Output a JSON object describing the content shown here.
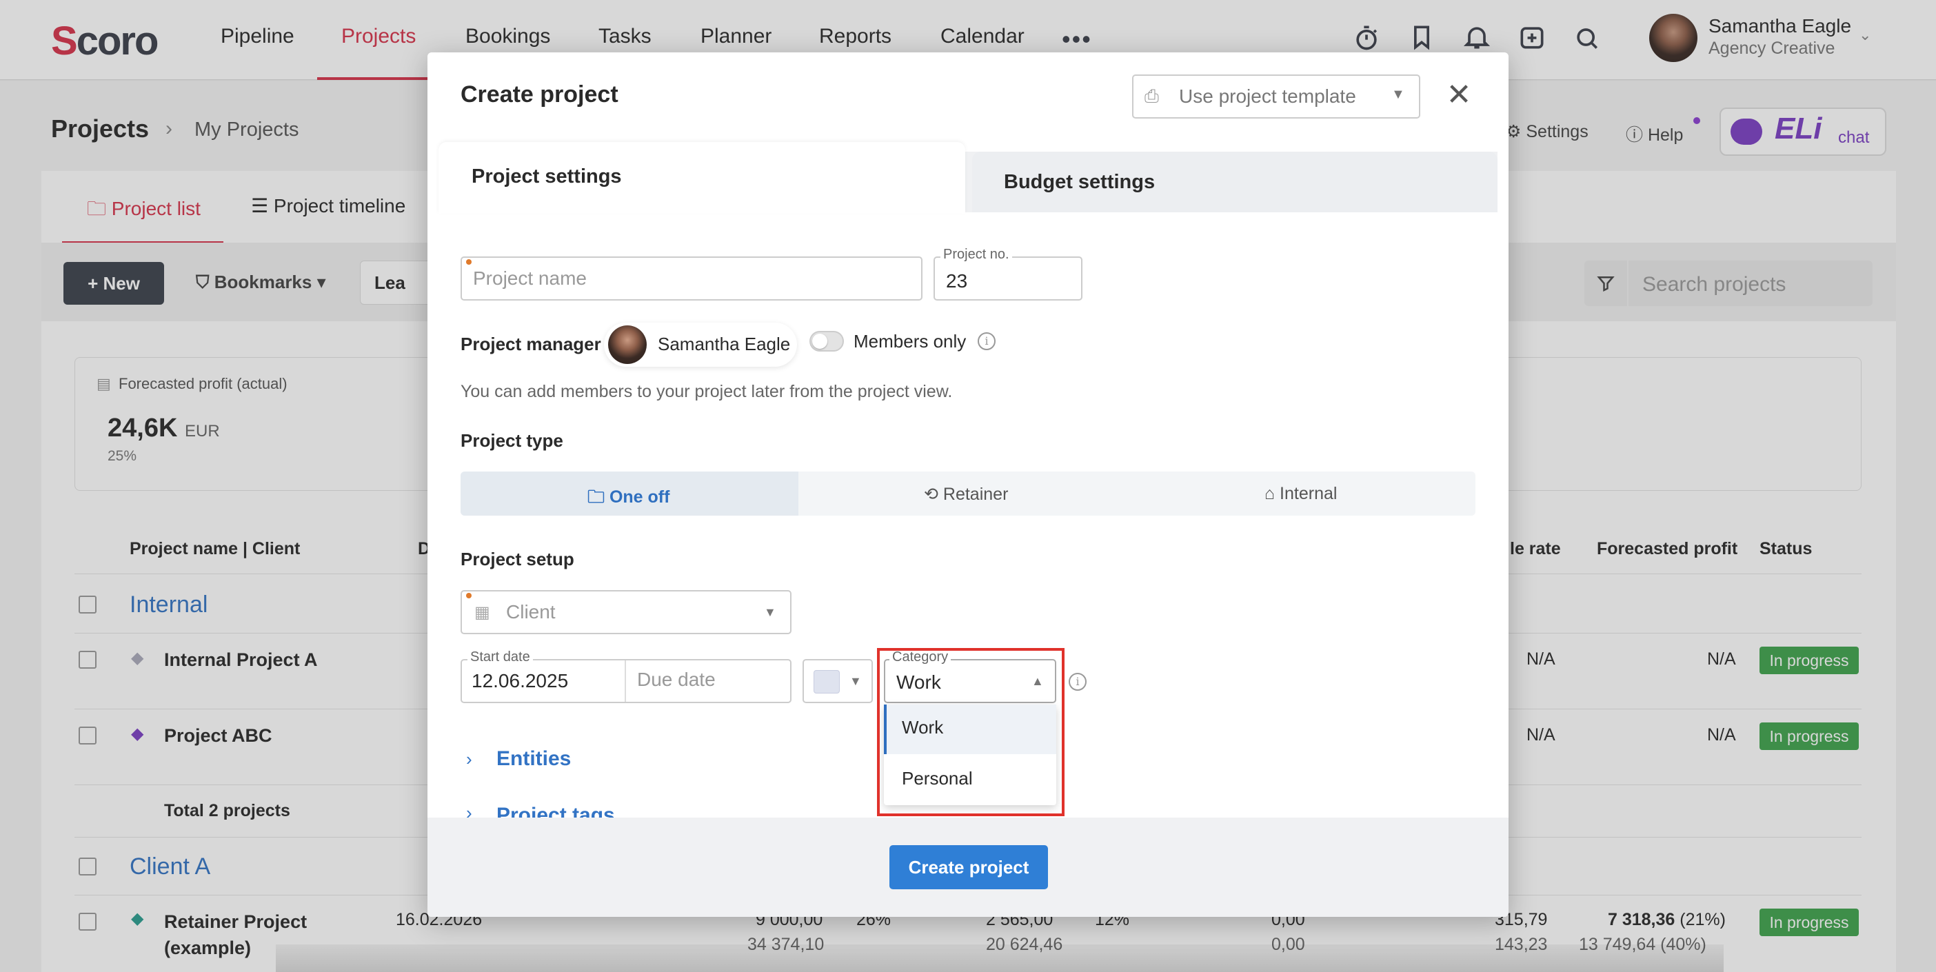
{
  "app": {
    "logo": "Scoro",
    "nav": [
      "Pipeline",
      "Projects",
      "Bookings",
      "Tasks",
      "Planner",
      "Reports",
      "Calendar"
    ],
    "active_nav": "Projects",
    "icons": [
      "more-icon",
      "stopwatch-icon",
      "bookmark-icon",
      "bell-icon",
      "add-icon",
      "search-icon"
    ],
    "user": {
      "name": "Samantha Eagle",
      "role": "Agency Creative"
    }
  },
  "page": {
    "breadcrumb": [
      "Projects",
      "My Projects"
    ],
    "settings": "Settings",
    "help": "Help",
    "eli": {
      "brand": "ELi",
      "suffix": "chat"
    },
    "tabs": [
      "Project list",
      "Project timeline"
    ],
    "toolbar": {
      "new": "+ New",
      "bookmarks": "Bookmarks",
      "lea": "Lea",
      "search_placeholder": "Search projects"
    },
    "forecast_card": {
      "label": "Forecasted profit (actual)",
      "value": "24,6K",
      "unit": "EUR",
      "percent": "25%"
    },
    "table": {
      "headers": [
        "Project name | Client",
        "D",
        "le rate",
        "Forecasted profit",
        "Status"
      ],
      "groups": [
        {
          "name": "Internal",
          "rows": [
            {
              "name": "Internal Project A",
              "rate": "N/A",
              "profit": "N/A",
              "status": "In progress"
            },
            {
              "name": "Project ABC",
              "rate": "N/A",
              "profit": "N/A",
              "status": "In progress"
            }
          ],
          "total": "Total 2 projects"
        },
        {
          "name": "Client A",
          "rows": [
            {
              "name_line1": "Retainer Project",
              "name_line2": "(example)",
              "date": "16.02.2026",
              "v1a": "9 000,00",
              "v1b": "34 374,10",
              "p1": "26%",
              "v2a": "2 565,00",
              "v2b": "20 624,46",
              "p2": "12%",
              "v3a": "0,00",
              "v3b": "0,00",
              "v4a": "315,79",
              "v4b": "143,23",
              "profit_a": "7 318,36",
              "profit_a_pct": "(21%)",
              "profit_b": "13 749,64 (40%)",
              "status": "In progress"
            }
          ]
        }
      ]
    }
  },
  "modal": {
    "title": "Create project",
    "template_placeholder": "Use project template",
    "tabs": {
      "project": "Project settings",
      "budget": "Budget settings"
    },
    "project_name_placeholder": "Project name",
    "project_no_label": "Project no.",
    "project_no": "23",
    "manager_label": "Project manager",
    "manager_name": "Samantha Eagle",
    "members_only": "Members only",
    "members_note": "You can add members to your project later from the project view.",
    "project_type_label": "Project type",
    "project_types": [
      "One off",
      "Retainer",
      "Internal"
    ],
    "selected_type": "One off",
    "setup_label": "Project setup",
    "client_placeholder": "Client",
    "start_date_label": "Start date",
    "start_date": "12.06.2025",
    "due_date_placeholder": "Due date",
    "category_label": "Category",
    "category_value": "Work",
    "category_options": [
      "Work",
      "Personal"
    ],
    "sections": [
      "Entities",
      "Project tags"
    ],
    "submit": "Create project",
    "colors": {
      "accent": "#2f7fd6",
      "highlight": "#e0322b",
      "brand": "#d6334a"
    }
  }
}
